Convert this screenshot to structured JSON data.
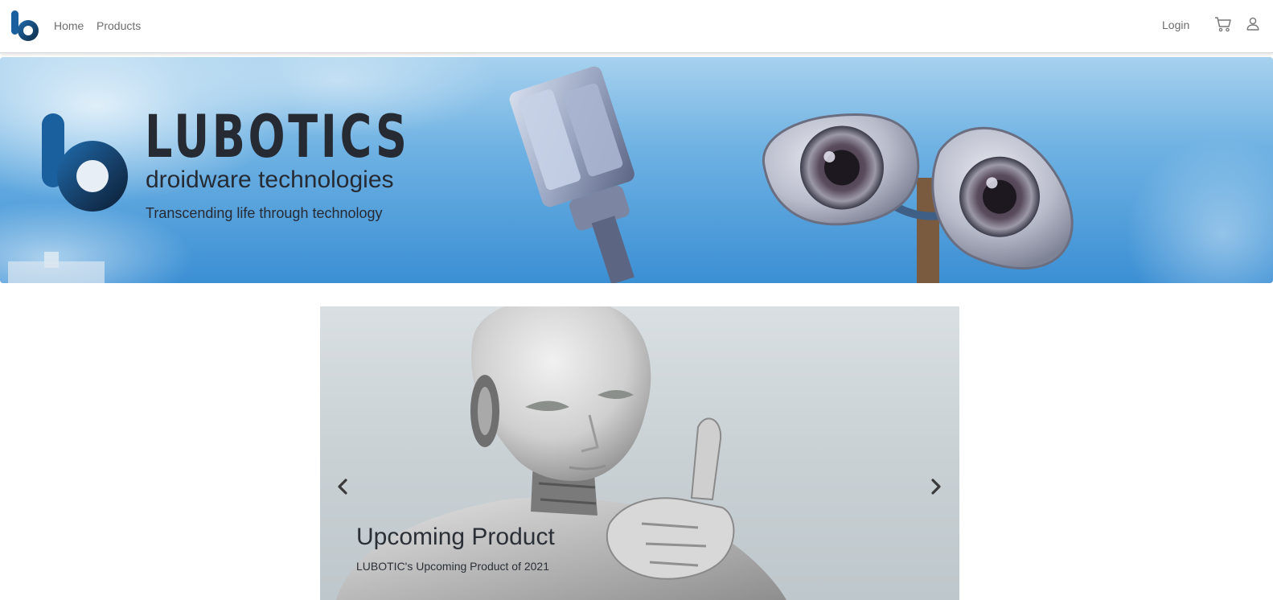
{
  "navbar": {
    "home_label": "Home",
    "products_label": "Products",
    "login_label": "Login",
    "cart_icon": "shopping-cart-icon",
    "user_icon": "user-icon"
  },
  "hero": {
    "brand": "LUBOTICS",
    "subtitle": "droidware technologies",
    "tagline": "Transcending life through technology"
  },
  "carousel": {
    "slide_title": "Upcoming Product",
    "slide_caption": "LUBOTIC's Upcoming Product of 2021",
    "prev_icon": "chevron-left-icon",
    "next_icon": "chevron-right-icon"
  },
  "colors": {
    "logo_blue": "#1a5f9e",
    "logo_dark": "#0f2a44",
    "brand_text": "#262a33",
    "nav_text": "#6d6d6d",
    "sky_blue": "#3b8fd4"
  }
}
